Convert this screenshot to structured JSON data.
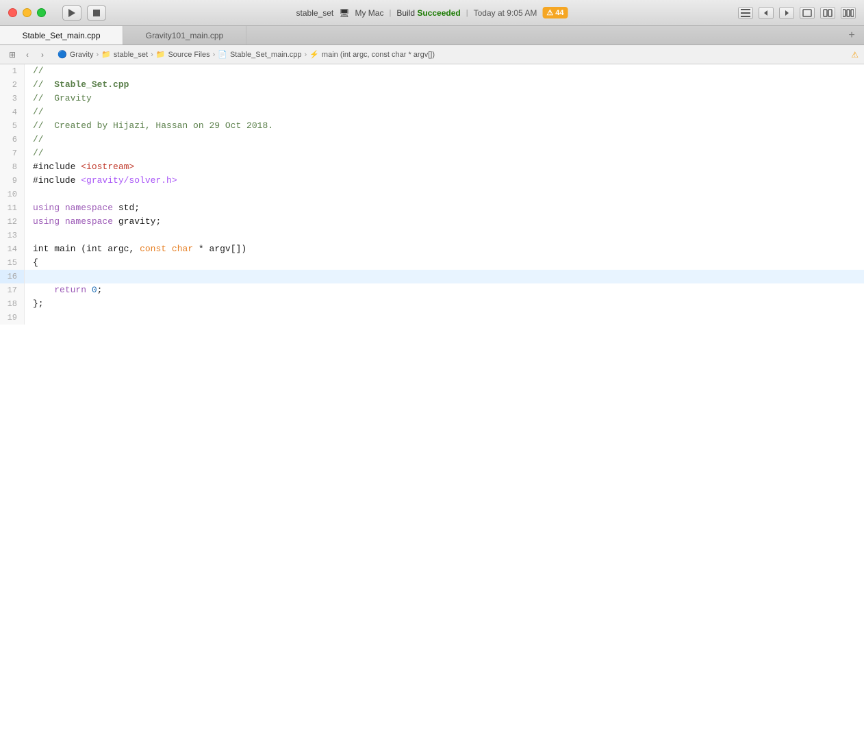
{
  "titlebar": {
    "scheme_name": "stable_set",
    "device_name": "My Mac",
    "separator": "|",
    "build_label": "Build",
    "build_status": "Succeeded",
    "time": "Today at 9:05 AM",
    "warning_icon": "⚠",
    "warning_count": "44"
  },
  "tabs": [
    {
      "id": "tab1",
      "label": "Stable_Set_main.cpp",
      "active": true
    },
    {
      "id": "tab2",
      "label": "Gravity101_main.cpp",
      "active": false
    }
  ],
  "breadcrumb": {
    "grid_icon": "⊞",
    "items": [
      {
        "icon": "🔵",
        "label": "Gravity"
      },
      {
        "icon": "📁",
        "label": "stable_set"
      },
      {
        "icon": "📁",
        "label": "Source Files"
      },
      {
        "icon": "📄",
        "label": "Stable_Set_main.cpp"
      },
      {
        "icon": "⚡",
        "label": "main (int argc, const char * argv[])"
      }
    ],
    "warning_icon": "⚠",
    "error_icon": "🔴"
  },
  "code": {
    "lines": [
      {
        "num": 1,
        "content": "//",
        "highlighted": false
      },
      {
        "num": 2,
        "content": "//  Stable_Set.cpp",
        "highlighted": false
      },
      {
        "num": 3,
        "content": "//  Gravity",
        "highlighted": false
      },
      {
        "num": 4,
        "content": "//",
        "highlighted": false
      },
      {
        "num": 5,
        "content": "//  Created by Hijazi, Hassan on 29 Oct 2018.",
        "highlighted": false
      },
      {
        "num": 6,
        "content": "//",
        "highlighted": false
      },
      {
        "num": 7,
        "content": "//",
        "highlighted": false
      },
      {
        "num": 8,
        "content": "#include <iostream>",
        "highlighted": false
      },
      {
        "num": 9,
        "content": "#include <gravity/solver.h>",
        "highlighted": false
      },
      {
        "num": 10,
        "content": "",
        "highlighted": false
      },
      {
        "num": 11,
        "content": "using namespace std;",
        "highlighted": false
      },
      {
        "num": 12,
        "content": "using namespace gravity;",
        "highlighted": false
      },
      {
        "num": 13,
        "content": "",
        "highlighted": false
      },
      {
        "num": 14,
        "content": "int main (int argc, const char * argv[])",
        "highlighted": false
      },
      {
        "num": 15,
        "content": "{",
        "highlighted": false
      },
      {
        "num": 16,
        "content": "",
        "highlighted": true
      },
      {
        "num": 17,
        "content": "    return 0;",
        "highlighted": false
      },
      {
        "num": 18,
        "content": "};",
        "highlighted": false
      },
      {
        "num": 19,
        "content": "",
        "highlighted": false
      }
    ]
  }
}
